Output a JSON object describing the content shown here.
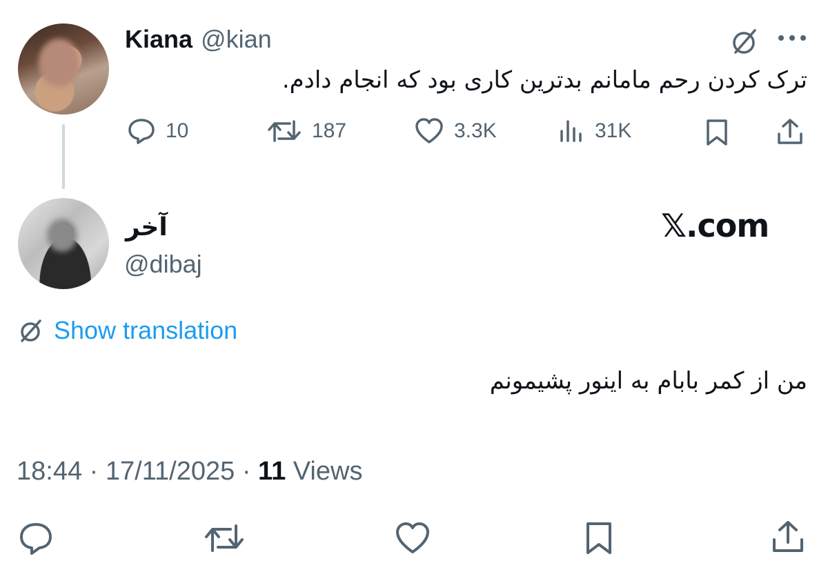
{
  "tweet1": {
    "name": "Kiana",
    "handle": "@kian",
    "text": "ترک کردن رحم مامانم بدترین کاری بود که انجام دادم.",
    "replies": "10",
    "retweets": "187",
    "likes": "3.3K",
    "views": "31K"
  },
  "tweet2": {
    "name": "آخر",
    "handle": "@dibaj",
    "watermark": "𝕏.com",
    "show_translation": "Show translation",
    "text": "من از کمر بابام به اینور پشیمونم",
    "time": "18:44",
    "date": "17/11/2025",
    "view_count": "11",
    "views_label": "Views",
    "separator": "·"
  },
  "colors": {
    "text": "#0f1419",
    "muted": "#536471",
    "link": "#1d9bf0"
  }
}
